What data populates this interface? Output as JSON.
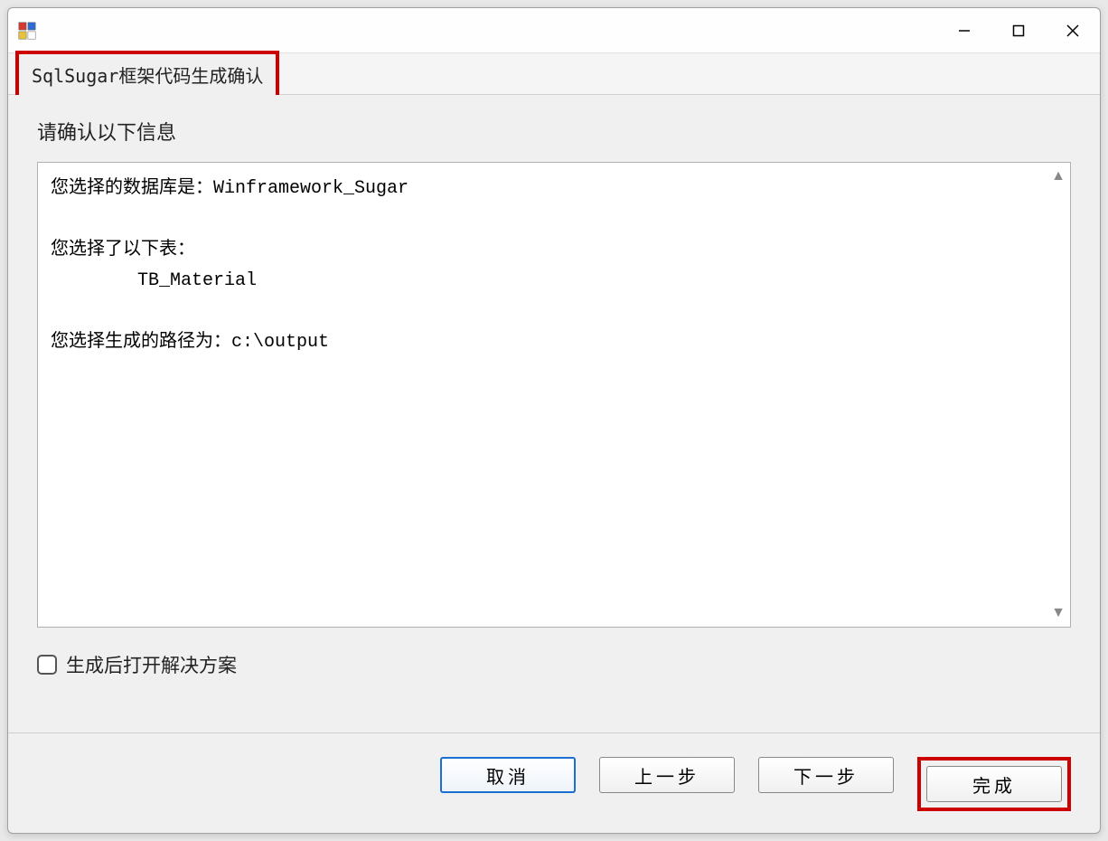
{
  "window": {
    "tab_label": "SqlSugar框架代码生成确认"
  },
  "content": {
    "heading": "请确认以下信息",
    "body": "您选择的数据库是：Winframework_Sugar\n\n您选择了以下表：\n        TB_Material\n\n您选择生成的路径为：c:\\output"
  },
  "checkbox": {
    "label": "生成后打开解决方案",
    "checked": false
  },
  "buttons": {
    "cancel": "取消",
    "prev": "上一步",
    "next": "下一步",
    "finish": "完成"
  },
  "highlight_color": "#cc0000"
}
